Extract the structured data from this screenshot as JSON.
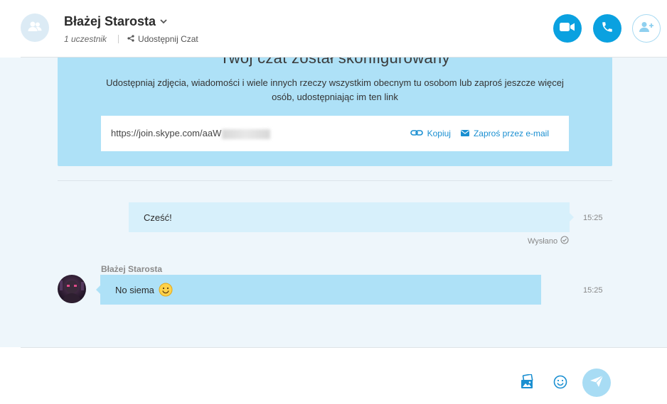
{
  "header": {
    "chat_title": "Błażej Starosta",
    "participants": "1 uczestnik",
    "share_label": "Udostępnij Czat"
  },
  "setup_card": {
    "heading": "Twój czat został skonfigurowany",
    "description": "Udostępniaj zdjęcia, wiadomości i wiele innych rzeczy wszystkim obecnym tu osobom lub zaproś jeszcze więcej osób, udostępniając im ten link",
    "link_visible": "https://join.skype.com/aaW",
    "copy_label": "Kopiuj",
    "email_label": "Zaproś przez e-mail"
  },
  "messages": [
    {
      "direction": "out",
      "text": "Cześć!",
      "time": "15:25",
      "status": "Wysłano"
    },
    {
      "direction": "in",
      "sender": "Błażej Starosta",
      "text": "No siema",
      "time": "15:25"
    }
  ],
  "compose": {
    "placeholder": ""
  },
  "colors": {
    "accent": "#0aa1e0",
    "card_bg": "#aee1f7",
    "conversation_bg": "#eef6fb",
    "outgoing_bubble": "#d7f0fb",
    "incoming_bubble": "#aee1f7",
    "link_blue": "#1a8fd1"
  },
  "icons": {
    "group_avatar": "group-icon",
    "video": "video-camera-icon",
    "call": "phone-icon",
    "add_people": "add-person-icon",
    "share": "share-icon",
    "copy": "link-icon",
    "email": "envelope-icon",
    "media": "image-icon",
    "emoji": "smiley-icon",
    "send": "send-icon"
  }
}
